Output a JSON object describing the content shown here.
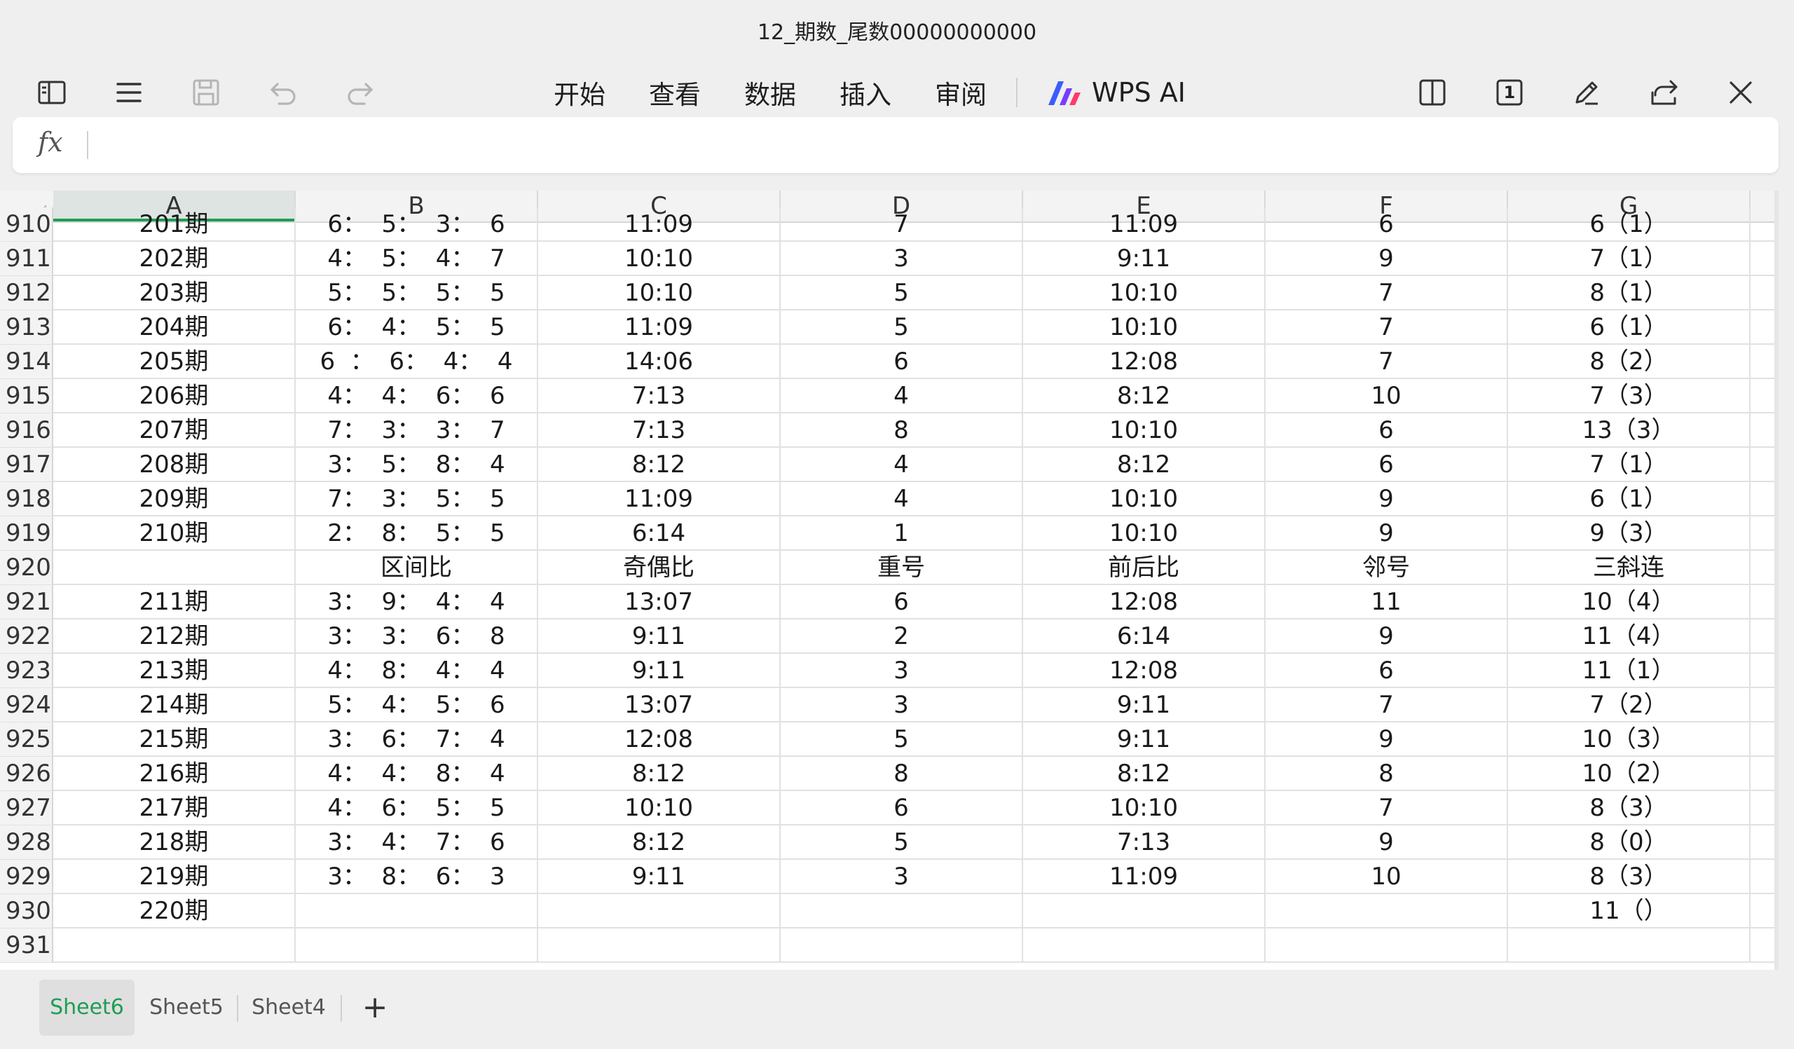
{
  "window": {
    "title": "12_期数_尾数00000000000"
  },
  "toolbar": {
    "menu": [
      "开始",
      "查看",
      "数据",
      "插入",
      "审阅"
    ],
    "ai_label": "WPS AI",
    "page_indicator": "1"
  },
  "formula_bar": {
    "fx_label": "fx",
    "value": ""
  },
  "columns": [
    "A",
    "B",
    "C",
    "D",
    "E",
    "F",
    "G"
  ],
  "selected_column": "A",
  "rows": [
    {
      "n": "910",
      "cells": [
        "201期",
        "6：  5：  3：  6",
        "11:09",
        "7",
        "11:09",
        "6",
        "6（1）"
      ]
    },
    {
      "n": "911",
      "cells": [
        "202期",
        "4：  5：  4：  7",
        "10:10",
        "3",
        "9:11",
        "9",
        "7（1）"
      ]
    },
    {
      "n": "912",
      "cells": [
        "203期",
        "5：  5：  5：  5",
        "10:10",
        "5",
        "10:10",
        "7",
        "8（1）"
      ]
    },
    {
      "n": "913",
      "cells": [
        "204期",
        "6：  4：  5：  5",
        "11:09",
        "5",
        "10:10",
        "7",
        "6（1）"
      ]
    },
    {
      "n": "914",
      "cells": [
        "205期",
        "6  ：  6：  4：  4",
        "14:06",
        "6",
        "12:08",
        "7",
        "8（2）"
      ]
    },
    {
      "n": "915",
      "cells": [
        "206期",
        "4：  4：  6：  6",
        "7:13",
        "4",
        "8:12",
        "10",
        "7（3）"
      ]
    },
    {
      "n": "916",
      "cells": [
        "207期",
        "7：  3：  3：  7",
        "7:13",
        "8",
        "10:10",
        "6",
        "13（3）"
      ]
    },
    {
      "n": "917",
      "cells": [
        "208期",
        "3：  5：  8：  4",
        "8:12",
        "4",
        "8:12",
        "6",
        "7（1）"
      ]
    },
    {
      "n": "918",
      "cells": [
        "209期",
        "7：  3：  5：  5",
        "11:09",
        "4",
        "10:10",
        "9",
        "6（1）"
      ]
    },
    {
      "n": "919",
      "cells": [
        "210期",
        "2：  8：  5：  5",
        "6:14",
        "1",
        "10:10",
        "9",
        "9（3）"
      ]
    },
    {
      "n": "920",
      "cells": [
        "",
        "区间比",
        "奇偶比",
        "重号",
        "前后比",
        "邻号",
        "三斜连"
      ]
    },
    {
      "n": "921",
      "cells": [
        "211期",
        "3：  9：  4：  4",
        "13:07",
        "6",
        "12:08",
        "11",
        "10（4）"
      ]
    },
    {
      "n": "922",
      "cells": [
        "212期",
        "3：  3：  6：  8",
        "9:11",
        "2",
        "6:14",
        "9",
        "11（4）"
      ]
    },
    {
      "n": "923",
      "cells": [
        "213期",
        "4：  8：  4：  4",
        "9:11",
        "3",
        "12:08",
        "6",
        "11（1）"
      ]
    },
    {
      "n": "924",
      "cells": [
        "214期",
        "5：  4：  5：  6",
        "13:07",
        "3",
        "9:11",
        "7",
        "7（2）"
      ]
    },
    {
      "n": "925",
      "cells": [
        "215期",
        "3：  6：  7：  4",
        "12:08",
        "5",
        "9:11",
        "9",
        "10（3）"
      ]
    },
    {
      "n": "926",
      "cells": [
        "216期",
        "4：  4：  8：  4",
        "8:12",
        "8",
        "8:12",
        "8",
        "10（2）"
      ]
    },
    {
      "n": "927",
      "cells": [
        "217期",
        "4：  6：  5：  5",
        "10:10",
        "6",
        "10:10",
        "7",
        "8（3）"
      ]
    },
    {
      "n": "928",
      "cells": [
        "218期",
        "3：  4：  7：  6",
        "8:12",
        "5",
        "7:13",
        "9",
        "8（0）"
      ]
    },
    {
      "n": "929",
      "cells": [
        "219期",
        "3：  8：  6：  3",
        "9:11",
        "3",
        "11:09",
        "10",
        "8（3）"
      ]
    },
    {
      "n": "930",
      "cells": [
        "220期",
        "",
        "",
        "",
        "",
        "",
        "11（）"
      ]
    },
    {
      "n": "931",
      "cells": [
        "",
        "",
        "",
        "",
        "",
        "",
        ""
      ]
    }
  ],
  "sheets": [
    {
      "name": "Sheet6",
      "active": true
    },
    {
      "name": "Sheet5",
      "active": false
    },
    {
      "name": "Sheet4",
      "active": false
    }
  ],
  "add_sheet_label": "+"
}
